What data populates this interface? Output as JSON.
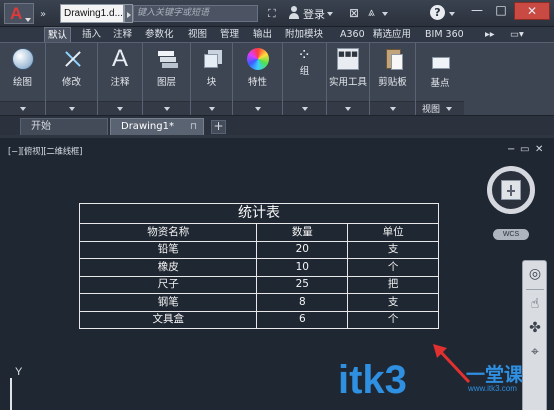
{
  "titlebar": {
    "logo": "A",
    "quick_access": "»",
    "doc_title": "Drawing1.d...",
    "search_placeholder": "键入关键字或短语",
    "binocular_icon": "binocular-icon",
    "login": "登录",
    "help": "?",
    "minimize": "—",
    "maximize": "□",
    "close": "✕"
  },
  "tabs": [
    "默认",
    "插入",
    "注释",
    "参数化",
    "视图",
    "管理",
    "输出",
    "附加模块",
    "A360",
    "精选应用",
    "BIM 360",
    "▸▸",
    "▭▾"
  ],
  "ribbon": {
    "groups": [
      {
        "label": "绘图",
        "icon": "circle-icon"
      },
      {
        "label": "修改",
        "icon": "modify-icon"
      },
      {
        "label": "注释",
        "icon": "text-icon"
      },
      {
        "label": "图层",
        "icon": "layers-icon"
      },
      {
        "label": "块",
        "icon": "block-icon"
      },
      {
        "label": "特性",
        "icon": "color-wheel-icon"
      },
      {
        "label": "组",
        "icon": "group-icon"
      },
      {
        "label": "实用工具",
        "icon": "calculator-icon"
      },
      {
        "label": "剪贴板",
        "icon": "clipboard-icon"
      },
      {
        "label": "基点",
        "icon": "base-point-icon"
      }
    ],
    "view_label": "视图",
    "util_icon_text": "■■■"
  },
  "filetabs": {
    "start": "开始",
    "doc": "Drawing1*",
    "close": "⊓",
    "add": "+"
  },
  "viewport": {
    "label": "[−][俯视][二维线框]",
    "ctrl_min": "−",
    "ctrl_restore": "▭",
    "ctrl_close": "✕",
    "wcs": "WCS",
    "ucs_y": "Y"
  },
  "table": {
    "title": "统计表",
    "headers": [
      "物资名称",
      "数量",
      "单位"
    ],
    "rows": [
      [
        "铅笔",
        "20",
        "支"
      ],
      [
        "橡皮",
        "10",
        "个"
      ],
      [
        "尺子",
        "25",
        "把"
      ],
      [
        "钢笔",
        "8",
        "支"
      ],
      [
        "文具盒",
        "6",
        "个"
      ]
    ]
  },
  "navbar": [
    "◎",
    "☝",
    "✤",
    "⌖"
  ],
  "watermark": {
    "text": "itk3",
    "cn": "一堂课",
    "url": "www.itk3.com"
  },
  "colors": {
    "background": "#1f2732",
    "watermark": "#2f8fe0",
    "arrow": "#e03030",
    "close_button": "#c84a42"
  }
}
